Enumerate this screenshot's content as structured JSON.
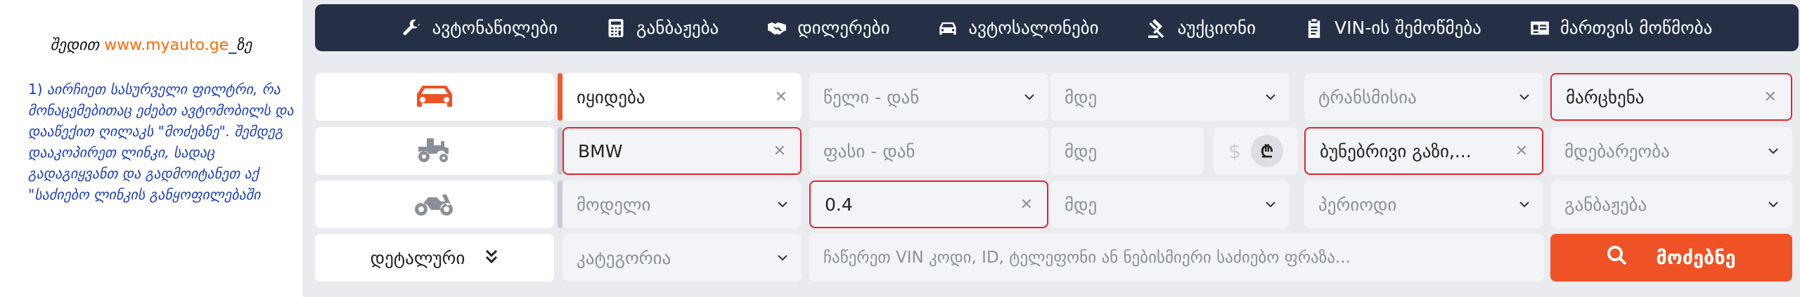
{
  "instructions": {
    "intro_before": "შედით ",
    "intro_link": "www.myauto.ge",
    "intro_after": "_ზე",
    "step_num": "1)",
    "step_text": "აირჩიეთ სასურველი ფილტრი, რა მონაცემებითაც ეძებთ ავტომობილს და დააწექით ღილაკს \"მოძებნე\". შემდეგ დააკოპირეთ ლინკი, სადაც გადაგიყვანთ და გადმოიტანეთ აქ \"საძიებო ლინკის განყოფილებაში"
  },
  "nav": {
    "items": [
      {
        "label": "ავტონაწილები",
        "icon": "wrench-icon"
      },
      {
        "label": "განბაჟება",
        "icon": "calculator-icon"
      },
      {
        "label": "დილერები",
        "icon": "handshake-icon"
      },
      {
        "label": "ავტოსალონები",
        "icon": "car-icon"
      },
      {
        "label": "აუქციონი",
        "icon": "gavel-icon"
      },
      {
        "label": "VIN-ის შემოწმება",
        "icon": "clipboard-icon"
      },
      {
        "label": "მართვის მოწმობა",
        "icon": "id-card-icon"
      }
    ]
  },
  "vehicle_types": [
    {
      "name": "car",
      "icon": "car-icon",
      "active": true
    },
    {
      "name": "tractor",
      "icon": "tractor-icon",
      "active": false
    },
    {
      "name": "motorcycle",
      "icon": "motorcycle-icon",
      "active": false
    }
  ],
  "filters": {
    "deal_type": "იყიდება",
    "year_from": "წელი - დან",
    "year_to": "მდე",
    "transmission": "ტრანსმისია",
    "steering": "მარცხენა",
    "manufacturer": "BMW",
    "price_from": "ფასი - დან",
    "price_to": "მდე",
    "currency_usd": "$",
    "currency_gel": "₾",
    "fuel": "ბუნებრივი გაზი,...",
    "location": "მდებარეობა",
    "model": "მოდელი",
    "engine_from": "0.4",
    "engine_to": "მდე",
    "period": "პერიოდი",
    "customs": "განბაჟება",
    "category": "კატეგორია"
  },
  "details_label": "დეტალური",
  "vin_placeholder": "ჩაწერეთ VIN კოდი, ID, ტელეფონი ან ნებისმიერი საძიებო ფრაზა...",
  "search_label": "მოძებნე",
  "colors": {
    "accent": "#ef5224",
    "nav_bg": "#253047",
    "error_border": "#e0262e"
  }
}
